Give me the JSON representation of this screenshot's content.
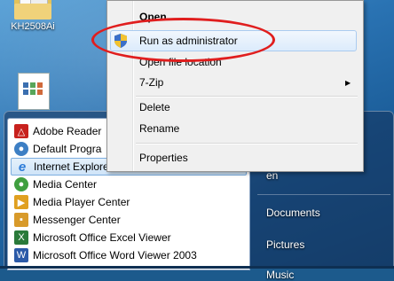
{
  "desktop": {
    "icons": [
      {
        "label": "KH2508Ai"
      },
      {
        "label": ""
      }
    ]
  },
  "context_menu": {
    "items": [
      {
        "label": "Open"
      },
      {
        "label": "Run as administrator"
      },
      {
        "label": "Open file location"
      },
      {
        "label": "7-Zip"
      },
      {
        "label": "Delete"
      },
      {
        "label": "Rename"
      },
      {
        "label": "Properties"
      }
    ]
  },
  "start_menu": {
    "programs": [
      {
        "label": "Adobe Reader",
        "icon": "adobe-reader-icon",
        "color": "#c8211d"
      },
      {
        "label": "Default Progra",
        "icon": "default-programs-icon",
        "color": "#3d7fc4"
      },
      {
        "label": "Internet Explorer",
        "icon": "internet-explorer-icon",
        "color": "#2b7bd8"
      },
      {
        "label": "Media Center",
        "icon": "media-center-icon",
        "color": "#3f9f3f"
      },
      {
        "label": "Media Player Center",
        "icon": "media-player-center-icon",
        "color": "#e0a020"
      },
      {
        "label": "Messenger Center",
        "icon": "messenger-center-icon",
        "color": "#d89a2a"
      },
      {
        "label": "Microsoft Office Excel Viewer",
        "icon": "excel-viewer-icon",
        "color": "#2a7a3a"
      },
      {
        "label": "Microsoft Office Word Viewer 2003",
        "icon": "word-viewer-icon",
        "color": "#2b5aa8"
      }
    ],
    "right_pane": {
      "partial_top": "en",
      "items": [
        {
          "label": "Documents"
        },
        {
          "label": "Pictures"
        },
        {
          "label": "Music"
        }
      ]
    }
  },
  "colors": {
    "highlight_border": "#e01e1e",
    "accent": "#2a73b3"
  }
}
